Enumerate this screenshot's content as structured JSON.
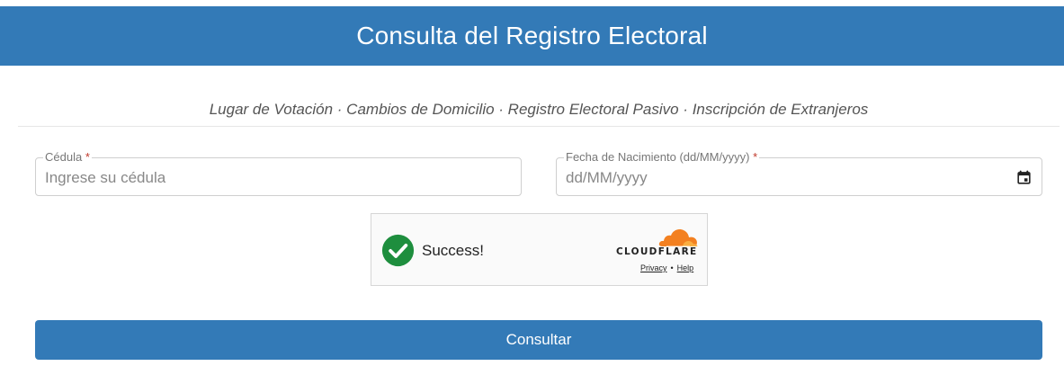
{
  "header": {
    "title": "Consulta del Registro Electoral"
  },
  "subtitle": "Lugar de Votación · Cambios de Domicilio · Registro Electoral Pasivo · Inscripción de Extranjeros",
  "form": {
    "cedula": {
      "label": "Cédula",
      "required_mark": "*",
      "value": "",
      "placeholder": "Ingrese su cédula"
    },
    "fecha": {
      "label": "Fecha de Nacimiento (dd/MM/yyyy)",
      "required_mark": "*",
      "value": "",
      "placeholder": "dd/MM/yyyy",
      "icon": "calendar-icon"
    },
    "submit_label": "Consultar"
  },
  "captcha": {
    "status_text": "Success!",
    "status_icon": "check-circle-icon",
    "brand": "CLOUDFLARE",
    "privacy_label": "Privacy",
    "separator": "•",
    "help_label": "Help"
  },
  "colors": {
    "primary": "#337ab7",
    "success": "#1e8e3e",
    "cloudflare_orange": "#f38020",
    "required": "#c0392b"
  }
}
